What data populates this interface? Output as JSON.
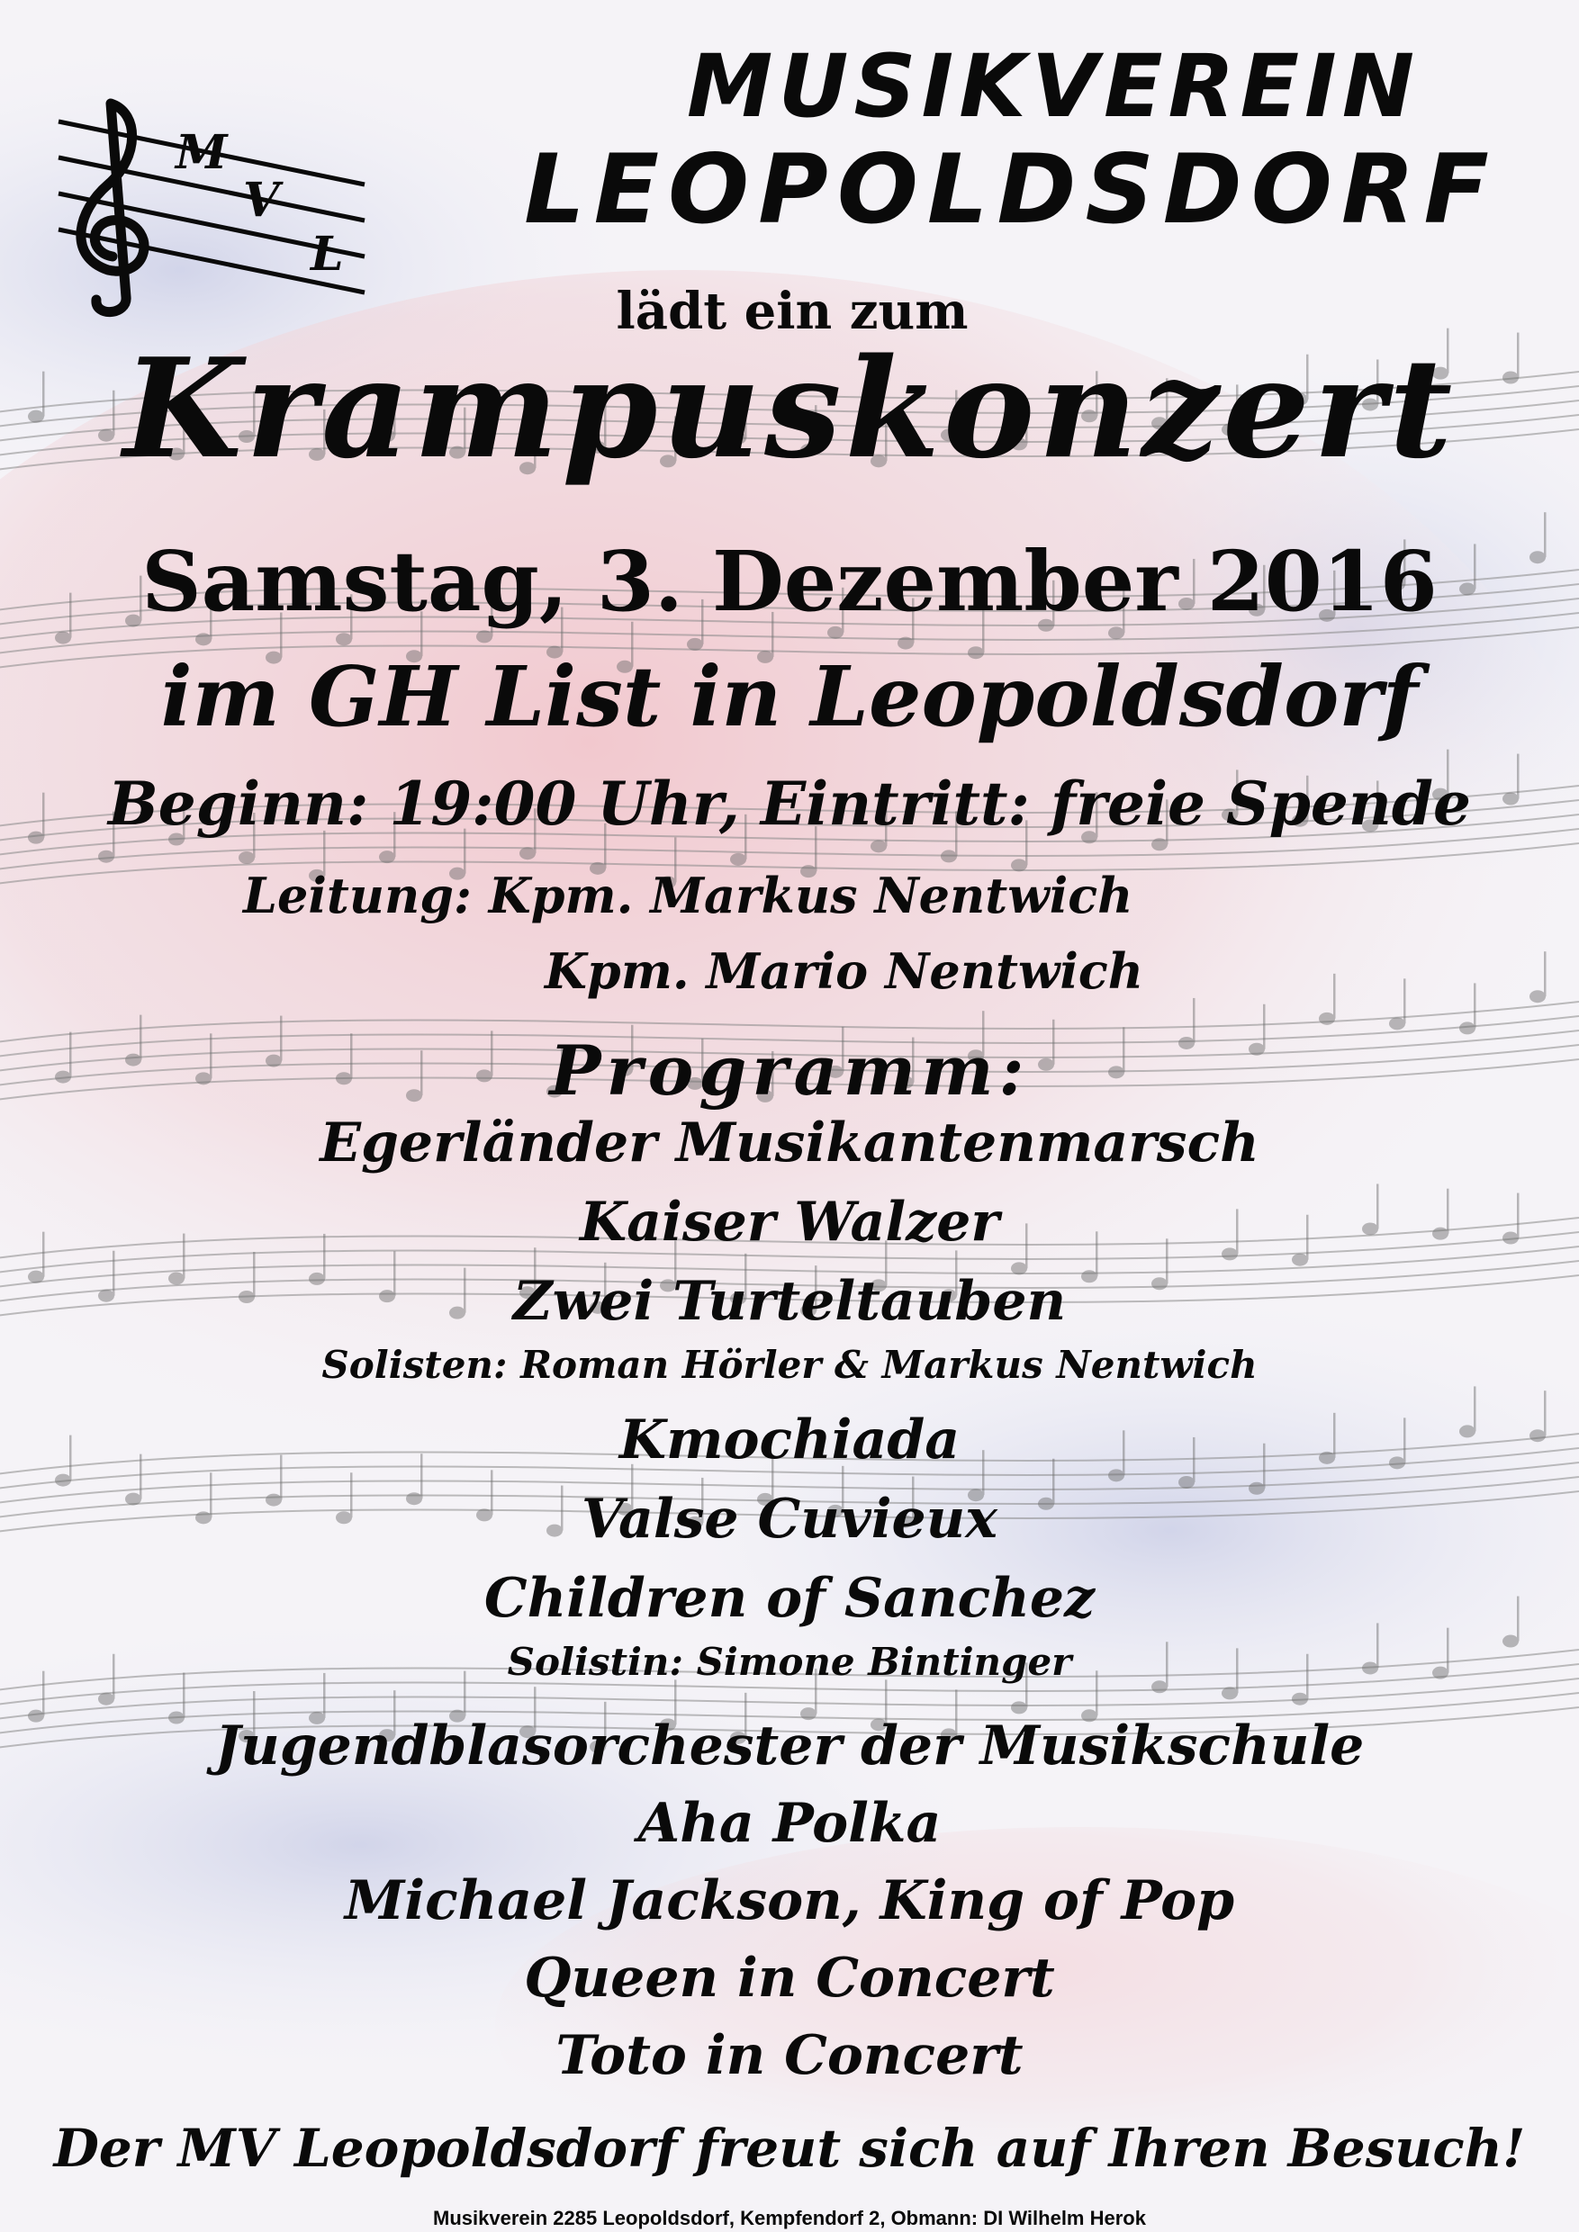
{
  "poster": {
    "club_line1": "MUSIKVEREIN",
    "club_line2": "LEOPOLDSDORF",
    "invite": "lädt ein zum",
    "event_title": "Krampuskonzert",
    "date": "Samstag, 3. Dezember 2016",
    "venue": "im GH List in Leopoldsdorf",
    "begin": "Beginn: 19:00 Uhr, Eintritt: freie Spende",
    "leadership": "Leitung: Kpm. Markus Nentwich",
    "leadership2": "Kpm. Mario Nentwich",
    "program_heading": "Programm:",
    "program": {
      "item1": "Egerländer Musikantenmarsch",
      "item2": "Kaiser Walzer",
      "item3": "Zwei Turteltauben",
      "soloists1": "Solisten: Roman Hörler & Markus Nentwich",
      "item4": "Kmochiada",
      "item5": "Valse Cuvieux",
      "item6": "Children of Sanchez",
      "soloist2": "Solistin: Simone Bintinger",
      "youth": "Jugendblasorchester der Musikschule",
      "item7": "Aha Polka",
      "item8": "Michael Jackson, King of Pop",
      "item9": "Queen in Concert",
      "item10": "Toto in Concert"
    },
    "closing": "Der MV Leopoldsdorf freut sich auf Ihren Besuch!",
    "footer": "Musikverein 2285 Leopoldsdorf, Kempfendorf 2, Obmann: DI Wilhelm Herok",
    "logo": {
      "letters": [
        "M",
        "V",
        "L"
      ],
      "icon": "treble-clef-icon"
    }
  },
  "colors": {
    "text": "#0a0a0a",
    "background": "#f6f3f6",
    "pink_tint": "#f2c6cc",
    "blue_tint": "#c9cde6",
    "staff_lines": "#8a8a8a"
  }
}
